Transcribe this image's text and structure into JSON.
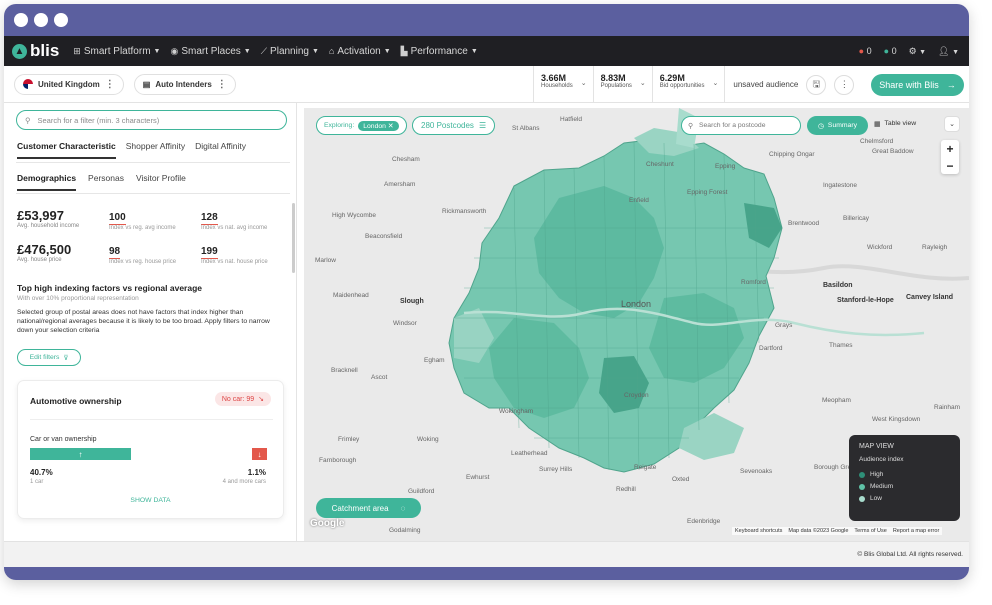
{
  "nav": {
    "logo": "blis",
    "items": [
      {
        "label": "Smart Platform",
        "icon": "grid-icon",
        "glyph": "⊞"
      },
      {
        "label": "Smart Places",
        "icon": "compass-icon",
        "glyph": "◉"
      },
      {
        "label": "Planning",
        "icon": "chart-line-icon",
        "glyph": "⟋"
      },
      {
        "label": "Activation",
        "icon": "home-icon",
        "glyph": "⌂"
      },
      {
        "label": "Performance",
        "icon": "bar-chart-icon",
        "glyph": "▙"
      }
    ],
    "red_count": "0",
    "green_count": "0"
  },
  "toolbar": {
    "country": "United Kingdom",
    "audience": "Auto Intenders",
    "stats": [
      {
        "value": "3.66M",
        "label": "Households"
      },
      {
        "value": "8.83M",
        "label": "Populations"
      },
      {
        "value": "6.29M",
        "label": "Bid opportunities"
      }
    ],
    "unsaved": "unsaved audience",
    "share": "Share with Blis"
  },
  "left": {
    "search_placeholder": "Search for a filter (min. 3 characters)",
    "tabs": [
      "Customer Characteristic",
      "Shopper Affinity",
      "Digital Affinity"
    ],
    "subtabs": [
      "Demographics",
      "Personas",
      "Visitor Profile"
    ],
    "metrics": [
      {
        "value": "£53,997",
        "label": "Avg. household income",
        "idx1": "100",
        "idx1_label": "Index vs reg. avg income",
        "idx2": "128",
        "idx2_label": "Index vs nat. avg income"
      },
      {
        "value": "£476,500",
        "label": "Avg. house price",
        "idx1": "98",
        "idx1_label": "Index vs reg. house price",
        "idx2": "199",
        "idx2_label": "Index vs nat. house price"
      }
    ],
    "heading": "Top high indexing factors vs regional average",
    "subheading": "With over 10% proportional representation",
    "paragraph": "Selected group of postal areas does not have factors that index higher than national/regional averages because it is likely to be too broad. Apply filters to narrow down your selection criteria",
    "edit_filters": "Edit filters",
    "card": {
      "title": "Automotive ownership",
      "badge": "No car: 99",
      "label": "Car or van ownership",
      "left_pct": "40.7%",
      "left_label": "1 car",
      "right_pct": "1.1%",
      "right_label": "4 and more cars",
      "show": "SHOW DATA"
    }
  },
  "map": {
    "exploring_label": "Exploring:",
    "exploring_chip": "London ✕",
    "postcodes": "280 Postcodes",
    "search_placeholder": "Search for a postcode",
    "summary": "Summary",
    "table_view": "Table view",
    "catchment": "Catchment area",
    "legend": {
      "title": "MAP VIEW",
      "subtitle": "Audience index",
      "items": [
        {
          "label": "High",
          "color": "#2e8f78"
        },
        {
          "label": "Medium",
          "color": "#5fc2a7"
        },
        {
          "label": "Low",
          "color": "#a8dccd"
        }
      ]
    },
    "places": [
      "Hatfield",
      "St Albans",
      "Chelmsford",
      "Great Baddow",
      "Chesham",
      "Amersham",
      "Epping",
      "Chipping Ongar",
      "Cheshunt",
      "Epping Forest",
      "Ingatestone",
      "Rickmansworth",
      "Enfield",
      "Brentwood",
      "Billericay",
      "High Wycombe",
      "Beaconsfield",
      "Wickford",
      "Rayleigh",
      "Marlow",
      "Maidenhead",
      "Slough",
      "Romford",
      "Basildon",
      "Stanford-le-Hope",
      "Canvey Island",
      "Windsor",
      "London",
      "Grays",
      "Dartford",
      "Egham",
      "Bracknell",
      "Ascot",
      "Thames",
      "Meopham",
      "Rainham",
      "Frimley",
      "Woking",
      "West Kingsdown",
      "Farnborough",
      "Leatherhead",
      "Sevenoaks",
      "Borough Green",
      "Ewhurst",
      "Surrey Hills",
      "Reigate",
      "Redhill",
      "Oxted",
      "Edenbridge",
      "Guildford",
      "Wokingham",
      "Croydon",
      "Godalming"
    ],
    "attribution": [
      "Keyboard shortcuts",
      "Map data ©2023 Google",
      "Terms of Use",
      "Report a map error"
    ]
  },
  "footer": "© Blis Global Ltd. All rights reserved."
}
